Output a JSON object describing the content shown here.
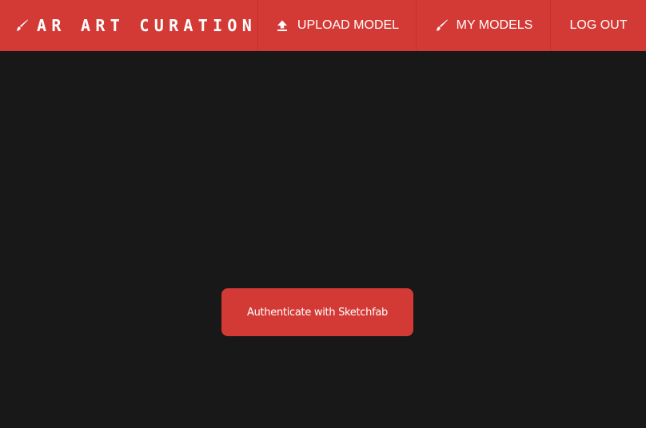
{
  "colors": {
    "accent": "#d43a35",
    "background": "#181818",
    "text": "#ffffff"
  },
  "navbar": {
    "brand": {
      "icon": "paintbrush-icon",
      "label": "AR ART CURATION"
    },
    "items": [
      {
        "icon": "upload-icon",
        "label": "UPLOAD MODEL"
      },
      {
        "icon": "paintbrush-icon",
        "label": "MY MODELS"
      },
      {
        "label": "LOG OUT"
      }
    ]
  },
  "main": {
    "auth_button_label": "Authenticate with Sketchfab"
  }
}
